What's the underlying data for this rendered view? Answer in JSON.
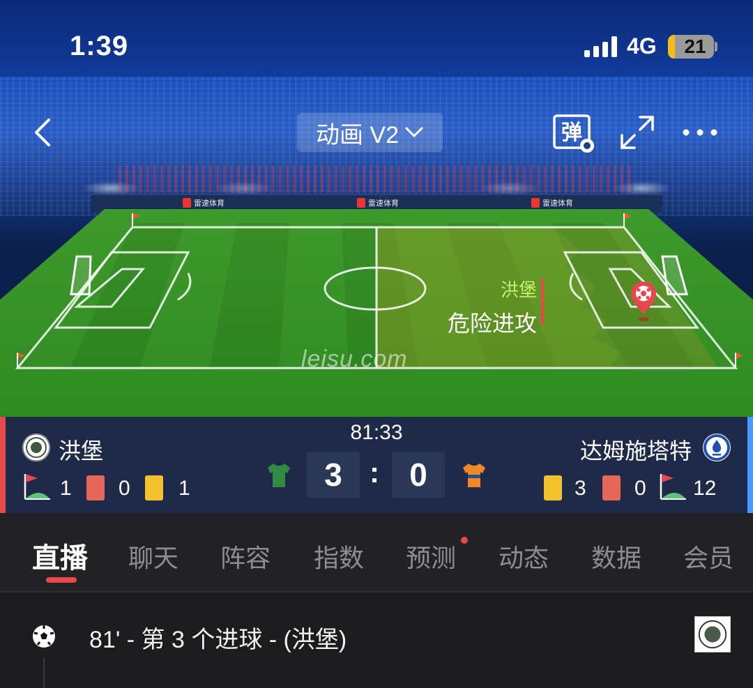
{
  "status_bar": {
    "time": "1:39",
    "network": "4G",
    "battery": "21"
  },
  "nav": {
    "mode_label": "动画 V2",
    "danmu_label": "弹"
  },
  "pitch": {
    "watermark": "leisu.com",
    "board_text": "雷速体育",
    "attack_team": "洪堡",
    "attack_text": "危险进攻"
  },
  "match": {
    "clock": "81:33",
    "home": {
      "name": "洪堡",
      "score": "3",
      "corners": "1",
      "red_cards": "0",
      "yellow_cards": "1",
      "bar_color": "#e5484d",
      "shirt_color": "#2e8b3f"
    },
    "away": {
      "name": "达姆施塔特",
      "score": "0",
      "yellow_cards": "3",
      "red_cards": "0",
      "corners": "12",
      "bar_color": "#4b9bff",
      "shirt_color": "#f08a24"
    },
    "separator": ":"
  },
  "tabs": [
    {
      "label": "直播",
      "active": true
    },
    {
      "label": "聊天"
    },
    {
      "label": "阵容"
    },
    {
      "label": "指数"
    },
    {
      "label": "预测",
      "dot": true
    },
    {
      "label": "动态"
    },
    {
      "label": "数据"
    },
    {
      "label": "会员"
    }
  ],
  "feed": [
    {
      "icon": "soccer-ball-icon",
      "text": "81' - 第 3 个进球 - (洪堡)"
    }
  ],
  "colors": {
    "accent_red": "#e5484d",
    "attack_green": "#c6f26a",
    "panel": "#1e2a47"
  }
}
